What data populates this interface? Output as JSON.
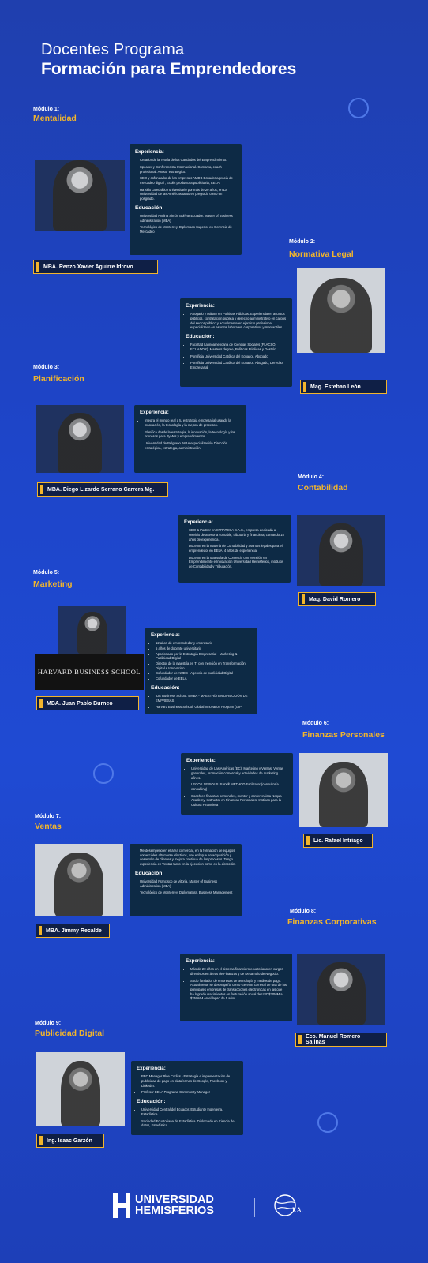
{
  "header": {
    "line1": "Docentes Programa",
    "line2": "Formación para Emprendedores"
  },
  "labels": {
    "experience": "Experiencia:",
    "education": "Educación:"
  },
  "modules": [
    {
      "label": "Módulo 1:",
      "name": "Mentalidad",
      "teacher": "MBA. Renzo Xavier Aguirre Idrovo",
      "experience": [
        "Creador de la Teoría de los Candados del Emprendimiento.",
        "Speaker y Conferencista Internacional. Comarca, coach profesional. Asesor estratégico.",
        "CEO y cofundador de las empresas AMDB Ecuador agencia de mercadeo digital , Ecolic productora publicitaria, EELA.",
        "Ha sido catedrático universitario por más de 20 años, en La Universidad de las Américas tanto en pregrado como en posgrado."
      ],
      "education": [
        "Universidad Andina Simón Bolívar Ecuador. Master of Business Administration (MBA)",
        "Tecnológico de Monterrey. Diplomado Superior en Gerencia de Mercadeo"
      ]
    },
    {
      "label": "Módulo 2:",
      "name": "Normativa Legal",
      "teacher": "Mag. Esteban León",
      "experience": [
        "Abogado y Máster en Políticas Públicas. Experiencia en asuntos públicos, contratación pública y derecho administrativo en cargos del sector público y actualmente en ejercicio profesional especializado en asuntos laborales, corporativos y mercantiles."
      ],
      "education": [
        "Facultad Latinoamericana de Ciencias Sociales (FLACSO, ECUADOR). Master's degree, Políticas Públicas y Gestión",
        "Pontificia Universidad Católica del Ecuador. Abogado",
        "Pontificia Universidad Católica del Ecuador. Abogado, Derecho Empresarial"
      ]
    },
    {
      "label": "Módulo 3:",
      "name": "Planificación",
      "teacher": "MBA. Diego Lizardo Serrano Carrera Mg.",
      "experience": [
        "Integra el mundo real a tu estrategia empresarial usando la innovación, la tecnología y la mejora de procesos.",
        "Planifica desde la estrategia, la innovación, la tecnología y los procesos para PyMes y emprendimientos.",
        "Universidad de Belgrano. MBA especialización Dirección estratégica, estrategia, administración."
      ],
      "education": []
    },
    {
      "label": "Módulo 4:",
      "name": "Contabilidad",
      "teacher": "Mag. David Romero",
      "experience": [
        "CEO & Partner en STRATEGA S.A.S., empresa dedicada al servicio de asesoría contable, tributaria y financiera, contando 15 años de experiencia.",
        "Docente en la materia de Contabilidad y asuntos legales para el emprendedor en EELA, 4 años de experiencia.",
        "Docente en la Maestría de Comercio con Mención en Emprendimiento e Innovación Universidad Hemisferios, módulos de Contabilidad y Tributación."
      ],
      "education": []
    },
    {
      "label": "Módulo 5:",
      "name": "Marketing",
      "teacher": "MBA. Juan Pablo Burneo",
      "experience": [
        "12 años de emprendedor y empresario",
        "5 años de docente universitario",
        "Apasionado por la Estrategia Empresarial - Marketing & Publicidad Digital",
        "Director de la maestría en TI con mención en Transformación Digital e Innovación",
        "Cofundador de AMDB - Agencia de publicidad Digital",
        "Cofundador de EELA"
      ],
      "education": [
        "IDE Business School. EMBA - MAESTRÍA EN DIRECCIÓN DE EMPRESAS",
        "Harvard Business School. Global Innovation Program (GIP)"
      ]
    },
    {
      "label": "Módulo 6:",
      "name": "Finanzas Personales",
      "teacher": "Lic. Rafael Intriago",
      "experience": [
        "Universidad de Las Américas (EC). Marketing y Ventas, Ventas generales, promoción comercial y actividades de marketing afines.",
        "LEGOS SERIOUS PLAY® METHOD Facilitator (consultoría consulting)",
        "Coach en finanzas personales, mentor y conferencista Nequa Academy. Instructor en Finanzas Personales. Instituto para la Cultura Financiera"
      ],
      "education": []
    },
    {
      "label": "Módulo 7:",
      "name": "Ventas",
      "teacher": "MBA. Jimmy Recalde",
      "experience": [
        "Me desempeño en el área comercial, en la formación de equipos comerciales altamente efectivos, con enfoque en adquisición y desarrollo de clientes y mejora continua de los procesos. Tengo experiencia en Ventas tanto en la ejecución como en la dirección."
      ],
      "education": [
        "Universidad Francisco de Vitoria. Master of Business Administration (MBA)",
        "Tecnológico de Monterrey. Diplomatura, Business Management"
      ]
    },
    {
      "label": "Módulo 8:",
      "name": "Finanzas Corporativas",
      "teacher": "Eco. Manuel Romero Salinas",
      "experience": [
        "Más de 20 años en el sistema financiero ecuatoriano en cargos directivos en áreas de Finanzas y de Desarrollo de Negocio.",
        "Socio fundador de empresas de tecnología y medios de pago. Actualmente se desempeña como Gerente General de una de las principales empresas de transacciones electrónicas en las que ha logrado crecimientos en facturación anual de USD$30MM a $250MM en el lapso de 5 años."
      ],
      "education": []
    },
    {
      "label": "Módulo 9:",
      "name": "Publicidad Digital",
      "teacher": "Ing. Isaac Garzón",
      "experience": [
        "PPC Manager Blue Corliss - Estrategia e implementación de publicidad de pago en plataformas de Google, Facebook y LinkedIn.",
        "Profesor EELA Programa Community Manager"
      ],
      "education": [
        "Universidad Central del Ecuador. Estudiante Ingeniería, Estadística",
        "Sociedad Ecuatoriana de Estadística. Diplomado en Ciencia de datos, Estadística"
      ]
    }
  ],
  "harvard_sign": "HARVARD BUSINESS SCHOOL",
  "footer": {
    "university_line1": "UNIVERSIDAD",
    "university_line2": "HEMISFERIOS",
    "ela_label": "LA."
  },
  "colors": {
    "accent": "#f2b52c",
    "card": "#0d2a45",
    "background": "#1f45c9"
  }
}
